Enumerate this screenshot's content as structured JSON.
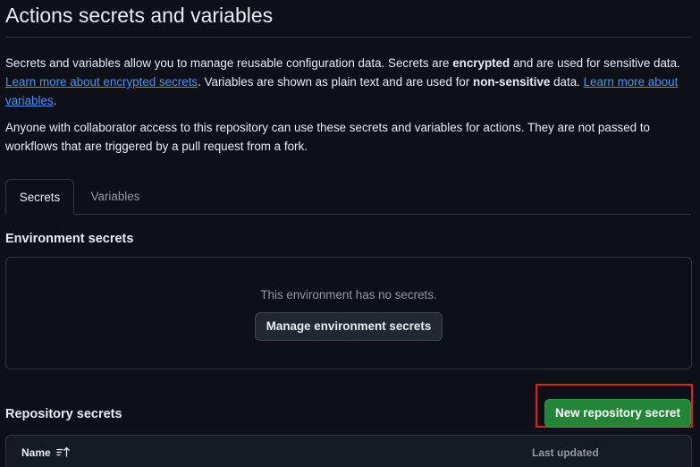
{
  "page": {
    "title": "Actions secrets and variables"
  },
  "description": {
    "p1_a": "Secrets and variables allow you to manage reusable configuration data. Secrets are ",
    "p1_b": "encrypted",
    "p1_c": " and are used for sensitive data. ",
    "p1_link1": "Learn more about encrypted secrets",
    "p1_d": ". Variables are shown as plain text and are used for ",
    "p1_e": "non-sensitive",
    "p1_f": " data. ",
    "p1_link2": "Learn more about variables",
    "p1_g": ".",
    "p2": "Anyone with collaborator access to this repository can use these secrets and variables for actions. They are not passed to workflows that are triggered by a pull request from a fork."
  },
  "tabs": [
    {
      "label": "Secrets",
      "selected": true
    },
    {
      "label": "Variables",
      "selected": false
    }
  ],
  "environment_secrets": {
    "heading": "Environment secrets",
    "empty_text": "This environment has no secrets.",
    "manage_button": "Manage environment secrets"
  },
  "repository_secrets": {
    "heading": "Repository secrets",
    "new_button": "New repository secret",
    "columns": {
      "name": "Name",
      "last_updated": "Last updated"
    }
  },
  "icons": {
    "sort": "sort-asc-icon"
  },
  "colors": {
    "background": "#0d1117",
    "link": "#4493f8",
    "primary_button": "#238636",
    "highlight": "#e0201c"
  }
}
